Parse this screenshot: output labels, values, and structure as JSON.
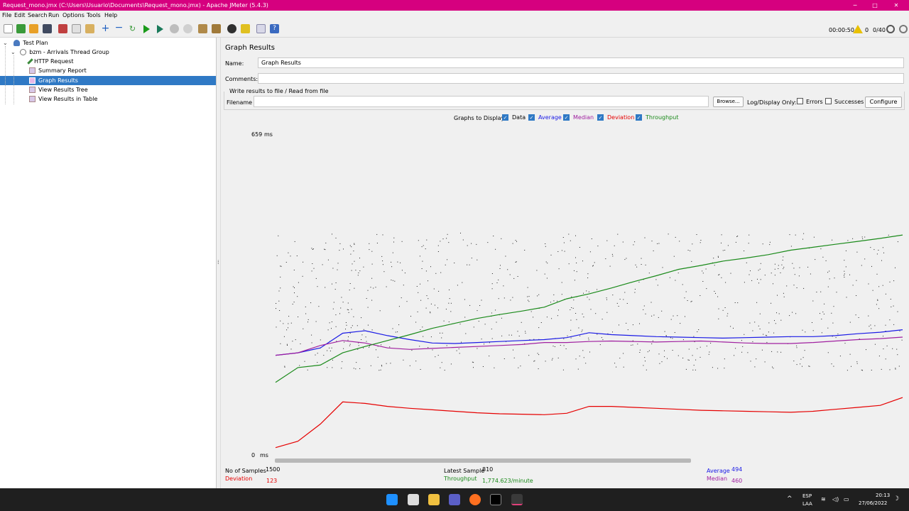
{
  "window": {
    "title": "Request_mono.jmx (C:\\Users\\Usuario\\Documents\\Request_mono.jmx) - Apache JMeter (5.4.3)",
    "min": "─",
    "max": "□",
    "close": "✕"
  },
  "menu": [
    "File",
    "Edit",
    "Search",
    "Run",
    "Options",
    "Tools",
    "Help"
  ],
  "toolbar": {
    "elapsed": "00:00:50",
    "warnings": "0",
    "threads": "0/40"
  },
  "tree": {
    "test_plan": "Test Plan",
    "thread_group": "bzm - Arrivals Thread Group",
    "items": [
      "HTTP Request",
      "Summary Report",
      "Graph Results",
      "View Results Tree",
      "View Results in Table"
    ]
  },
  "panel": {
    "title": "Graph Results",
    "name_label": "Name:",
    "name_value": "Graph Results",
    "comments_label": "Comments:",
    "comments_value": "",
    "write_group": "Write results to file / Read from file",
    "filename_label": "Filename",
    "filename_value": "",
    "browse": "Browse...",
    "log_display": "Log/Display Only:",
    "errors": "Errors",
    "successes": "Successes",
    "configure": "Configure",
    "graphs_to_display": "Graphs to Display",
    "checks": [
      {
        "label": "Data",
        "color": "#000000"
      },
      {
        "label": "Average",
        "color": "#1a1ae6"
      },
      {
        "label": "Median",
        "color": "#a020a0"
      },
      {
        "label": "Deviation",
        "color": "#e60000"
      },
      {
        "label": "Throughput",
        "color": "#1a8a1a"
      }
    ]
  },
  "chart_data": {
    "type": "scatter",
    "y_top_label": "659",
    "y_bottom_label": "0",
    "y_unit": "ms",
    "ylim": [
      0,
      659
    ],
    "series": [
      {
        "name": "Average",
        "color": "#1a1ae6",
        "values": [
          200,
          205,
          215,
          245,
          250,
          240,
          232,
          225,
          224,
          226,
          228,
          230,
          232,
          236,
          246,
          242,
          240,
          238,
          237,
          236,
          235,
          236,
          237,
          238,
          238,
          240,
          244,
          247,
          252
        ]
      },
      {
        "name": "Median",
        "color": "#a020a0",
        "values": [
          200,
          205,
          220,
          230,
          225,
          215,
          212,
          214,
          216,
          218,
          220,
          222,
          226,
          226,
          228,
          229,
          228,
          227,
          228,
          229,
          227,
          225,
          224,
          224,
          226,
          229,
          232,
          234,
          237
        ]
      },
      {
        "name": "Deviation",
        "color": "#e60000",
        "values": [
          12,
          25,
          60,
          105,
          102,
          96,
          92,
          89,
          86,
          83,
          81,
          80,
          79,
          82,
          96,
          96,
          94,
          92,
          90,
          88,
          87,
          86,
          85,
          84,
          86,
          90,
          94,
          98,
          114
        ]
      },
      {
        "name": "Throughput",
        "color": "#1a8a1a",
        "values": [
          145,
          175,
          180,
          205,
          218,
          230,
          242,
          255,
          265,
          275,
          283,
          290,
          298,
          315,
          325,
          337,
          350,
          362,
          375,
          383,
          392,
          398,
          405,
          414,
          420,
          426,
          432,
          438,
          445
        ]
      }
    ]
  },
  "stats": {
    "samples_label": "No of Samples",
    "samples_value": "1500",
    "deviation_label": "Deviation",
    "deviation_value": "123",
    "latest_label": "Latest Sample",
    "latest_value": "810",
    "throughput_label": "Throughput",
    "throughput_value": "1,774.623/minute",
    "average_label": "Average",
    "average_value": "494",
    "median_label": "Median",
    "median_value": "460"
  },
  "taskbar": {
    "lang1": "ESP",
    "lang2": "LAA",
    "time": "20:13",
    "date": "27/06/2022"
  }
}
